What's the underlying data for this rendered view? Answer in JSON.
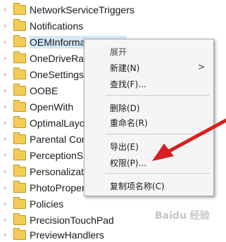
{
  "tree": {
    "items": [
      {
        "label": "NetworkServiceTriggers"
      },
      {
        "label": "Notifications"
      },
      {
        "label": "OEMInformation",
        "selected": true
      },
      {
        "label": "OneDriveRamps"
      },
      {
        "label": "OneSettings"
      },
      {
        "label": "OOBE"
      },
      {
        "label": "OpenWith"
      },
      {
        "label": "OptimalLayout"
      },
      {
        "label": "Parental Controls"
      },
      {
        "label": "PerceptionSimulation"
      },
      {
        "label": "Personalization"
      },
      {
        "label": "PhotoPropertyHandler"
      },
      {
        "label": "Policies"
      },
      {
        "label": "PrecisionTouchPad"
      },
      {
        "label": "PreviewHandlers"
      }
    ]
  },
  "context_menu": {
    "expand": "展开",
    "new": "新建(N)",
    "find": "查找(F)...",
    "delete": "删除(D)",
    "rename": "重命名(R)",
    "export": "导出(E)",
    "permissions": "权限(P)...",
    "copy_key_name": "复制项名称(C)",
    "submenu_arrow": ">"
  },
  "annotation": {
    "arrow_color": "#d6201f"
  },
  "watermark": {
    "text": "Baidu 经验"
  },
  "icons": {
    "chevron": "chevron-right-icon",
    "folder": "folder-icon"
  }
}
